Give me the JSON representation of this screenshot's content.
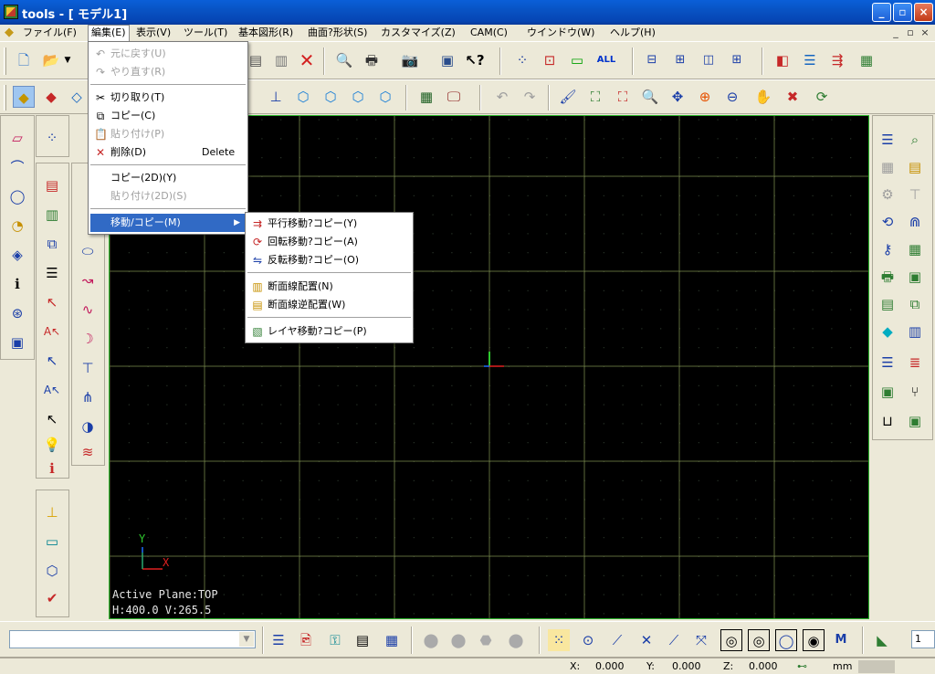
{
  "window": {
    "title": "tools - [ モデル1]"
  },
  "menubar": {
    "items": [
      {
        "label": "ファイル(F)"
      },
      {
        "label": "編集(E)"
      },
      {
        "label": "表示(V)"
      },
      {
        "label": "ツール(T)"
      },
      {
        "label": "基本図形(R)"
      },
      {
        "label": "曲面?形状(S)"
      },
      {
        "label": "カスタマイズ(Z)"
      },
      {
        "label": "CAM(C)"
      },
      {
        "label": "ウインドウ(W)"
      },
      {
        "label": "ヘルプ(H)"
      }
    ]
  },
  "toolbar_text": {
    "all": "ALL"
  },
  "edit_menu": {
    "undo": "元に戻す(U)",
    "redo": "やり直す(R)",
    "cut": "切り取り(T)",
    "copy": "コピー(C)",
    "paste": "貼り付け(P)",
    "delete": "削除(D)",
    "delete_shortcut": "Delete",
    "copy2d": "コピー(2D)(Y)",
    "paste2d": "貼り付け(2D)(S)",
    "move_copy": "移動/コピー(M)"
  },
  "submenu": {
    "parallel": "平行移動?コピー(Y)",
    "rotate": "回転移動?コピー(A)",
    "reflect": "反転移動?コピー(O)",
    "section": "断面線配置(N)",
    "section_rev": "断面線逆配置(W)",
    "layer": "レイヤ移動?コピー(P)"
  },
  "viewport": {
    "active_plane": "Active Plane:TOP",
    "hv": "H:400.0 V:265.5",
    "axis_x": "X",
    "axis_y": "Y"
  },
  "bottom_toolbar": {
    "marker_label": "M"
  },
  "status": {
    "x_label": "X:",
    "x_value": "0.000",
    "y_label": "Y:",
    "y_value": "0.000",
    "z_label": "Z:",
    "z_value": "0.000",
    "unit": "mm",
    "snap_value": "1"
  }
}
